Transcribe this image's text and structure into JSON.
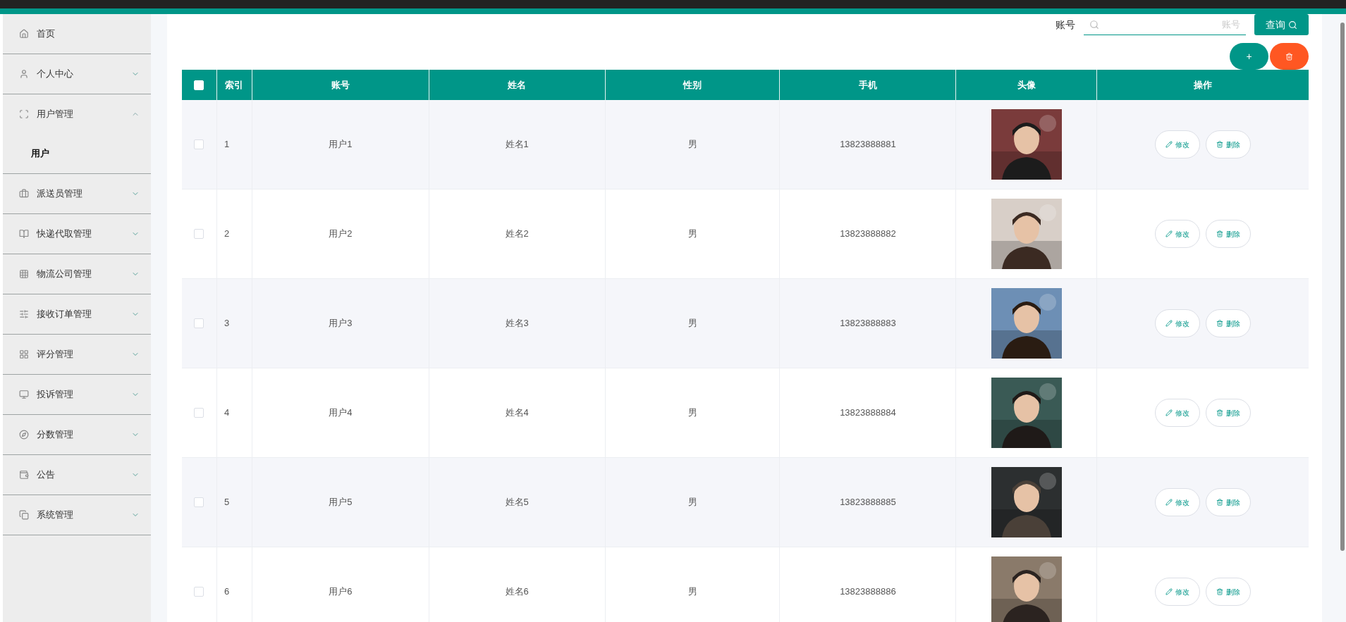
{
  "sidebar": {
    "items": [
      {
        "label": "首页"
      },
      {
        "label": "个人中心",
        "expanded": false
      },
      {
        "label": "用户管理",
        "expanded": true,
        "children": [
          {
            "label": "用户",
            "selected": true
          }
        ]
      },
      {
        "label": "派送员管理",
        "expanded": false
      },
      {
        "label": "快递代取管理",
        "expanded": false
      },
      {
        "label": "物流公司管理",
        "expanded": false
      },
      {
        "label": "接收订单管理",
        "expanded": false
      },
      {
        "label": "评分管理",
        "expanded": false
      },
      {
        "label": "投诉管理",
        "expanded": false
      },
      {
        "label": "分数管理",
        "expanded": false
      },
      {
        "label": "公告",
        "expanded": false
      },
      {
        "label": "系统管理",
        "expanded": false
      }
    ]
  },
  "search": {
    "label": "账号",
    "placeholder": "账号",
    "button": "查询"
  },
  "toolbar": {
    "add": "+"
  },
  "table": {
    "select_all_checked": false,
    "columns": [
      "索引",
      "账号",
      "姓名",
      "性别",
      "手机",
      "头像",
      "操作"
    ],
    "rows": [
      {
        "checked": false,
        "index": "1",
        "account": "用户1",
        "name": "姓名1",
        "gender": "男",
        "phone": "13823888881",
        "edit": "修改",
        "delete": "删除"
      },
      {
        "checked": false,
        "index": "2",
        "account": "用户2",
        "name": "姓名2",
        "gender": "男",
        "phone": "13823888882",
        "edit": "修改",
        "delete": "删除"
      },
      {
        "checked": false,
        "index": "3",
        "account": "用户3",
        "name": "姓名3",
        "gender": "男",
        "phone": "13823888883",
        "edit": "修改",
        "delete": "删除"
      },
      {
        "checked": false,
        "index": "4",
        "account": "用户4",
        "name": "姓名4",
        "gender": "男",
        "phone": "13823888884",
        "edit": "修改",
        "delete": "删除"
      },
      {
        "checked": false,
        "index": "5",
        "account": "用户5",
        "name": "姓名5",
        "gender": "男",
        "phone": "13823888885",
        "edit": "修改",
        "delete": "删除"
      },
      {
        "checked": false,
        "index": "6",
        "account": "用户6",
        "name": "姓名6",
        "gender": "男",
        "phone": "13823888886",
        "edit": "修改",
        "delete": "删除"
      }
    ]
  }
}
